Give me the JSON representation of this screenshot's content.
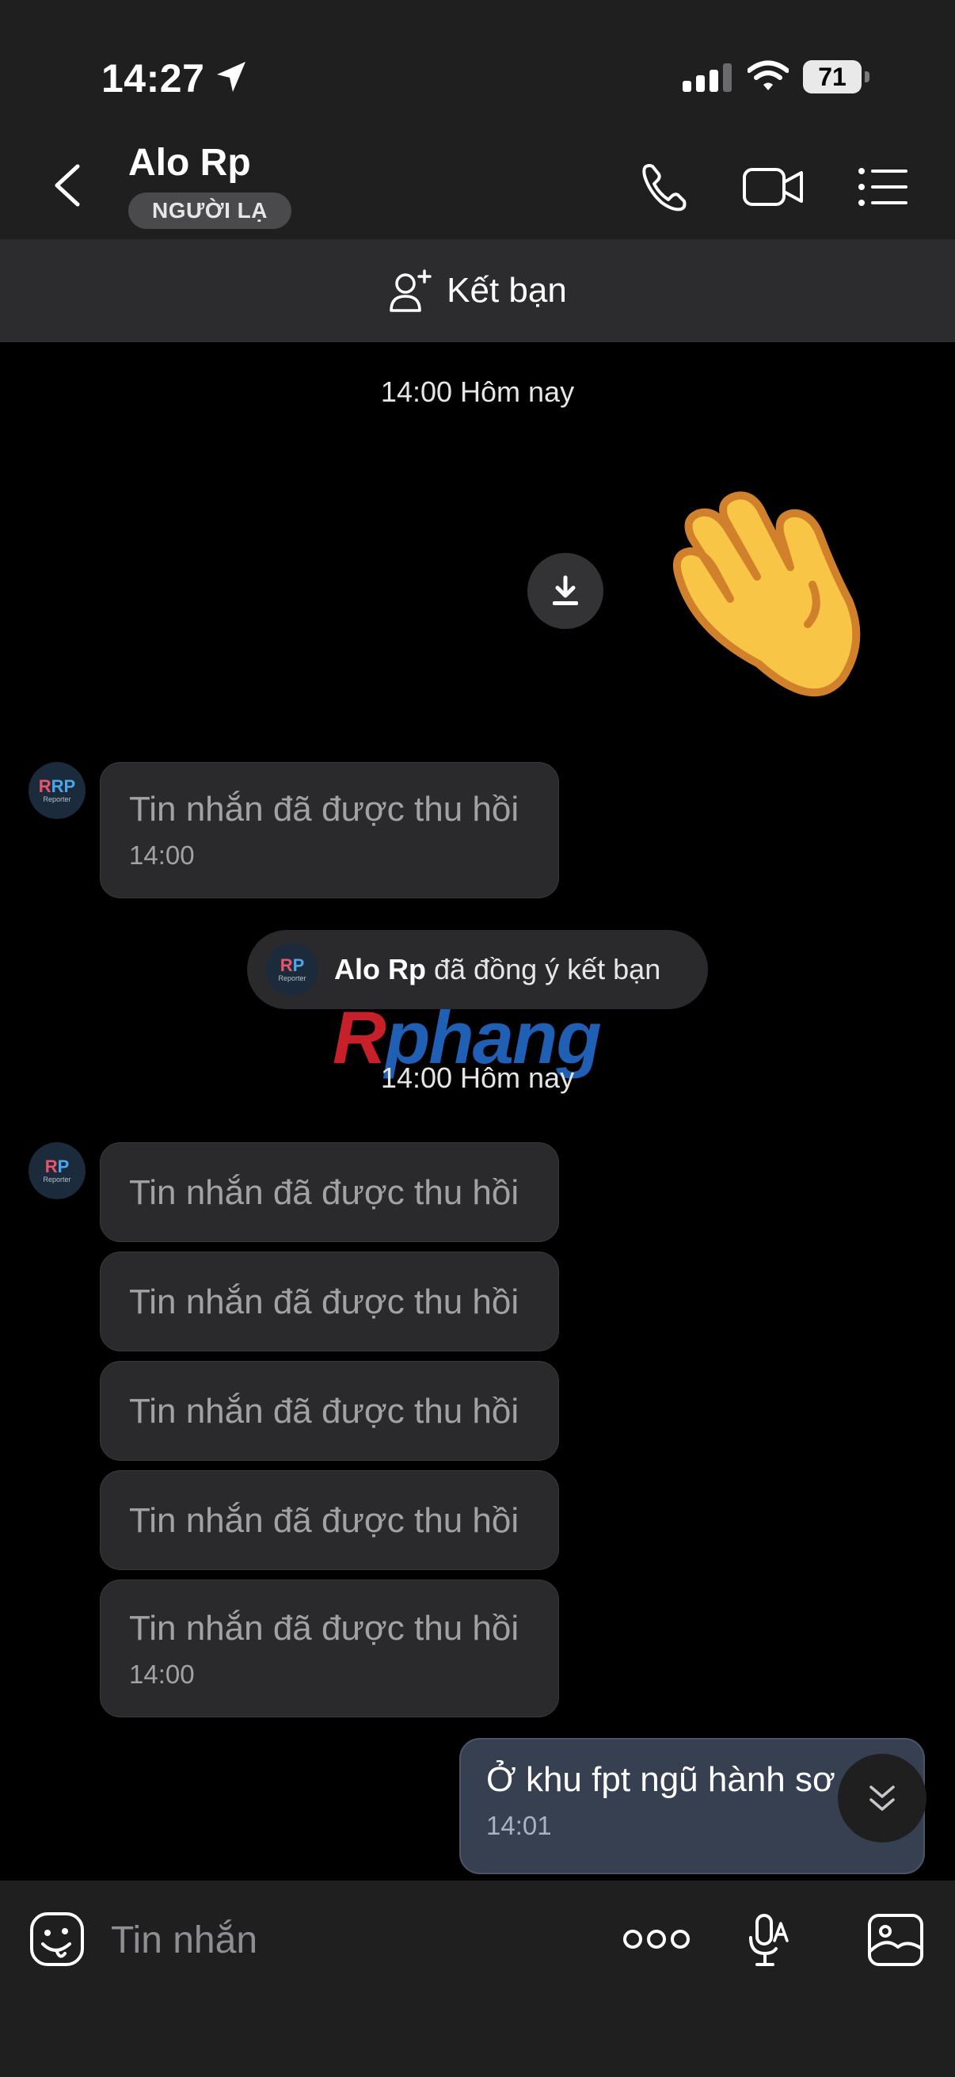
{
  "status_bar": {
    "time": "14:27",
    "battery": "71",
    "icons": [
      "location-arrow-icon",
      "cellular-signal-icon",
      "wifi-icon",
      "battery-icon"
    ]
  },
  "header": {
    "title": "Alo Rp",
    "badge": "NGƯỜI LẠ",
    "icons": [
      "back-chevron-icon",
      "phone-icon",
      "video-camera-icon",
      "list-menu-icon"
    ]
  },
  "add_friend": {
    "label": "Kết bạn",
    "icon": "add-person-icon"
  },
  "chat": {
    "divider_1": "14:00 Hôm nay",
    "divider_2": "14:00 Hôm nay",
    "avatar_text": "RP",
    "avatar_sub": "Reporter",
    "first_group": {
      "messages": [
        "Tin nhắn đã được thu hồi"
      ],
      "time": "14:00"
    },
    "system_message": {
      "name": "Alo Rp",
      "text": "đã đồng ý kết bạn"
    },
    "watermark": "Rphang",
    "second_group": {
      "messages": [
        "Tin nhắn đã được thu hồi",
        "Tin nhắn đã được thu hồi",
        "Tin nhắn đã được thu hồi",
        "Tin nhắn đã được thu hồi",
        "Tin nhắn đã được thu hồi"
      ],
      "time": "14:00"
    },
    "outgoing": {
      "text": "Ở khu fpt ngũ hành sơ",
      "time": "14:01"
    }
  },
  "input": {
    "placeholder": "Tin nhắn",
    "icons": [
      "emoji-sticker-icon",
      "more-dots-icon",
      "voice-to-text-icon",
      "image-gallery-icon"
    ]
  },
  "colors": {
    "background": "#000000",
    "header_bg": "#1f1f20",
    "incoming_bubble": "#2a2a2c",
    "outgoing_bubble": "#364051",
    "recalled_text": "#a2a2a6"
  }
}
